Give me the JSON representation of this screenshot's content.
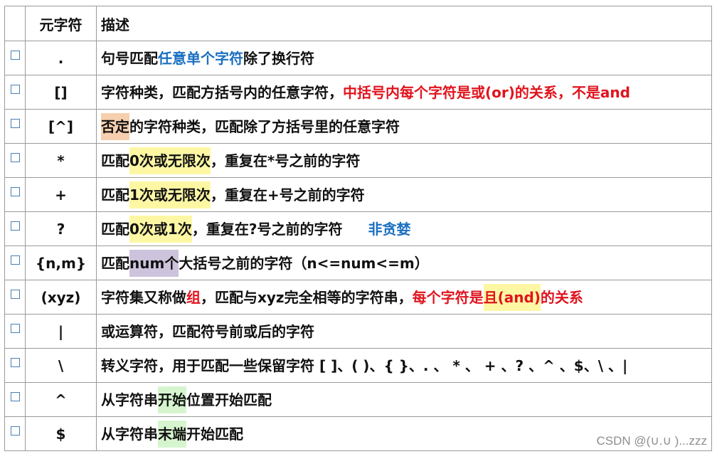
{
  "table": {
    "headers": {
      "symbol": "元字符",
      "description": "描述"
    },
    "rows": [
      {
        "symbol": ".",
        "segments": [
          {
            "text": "句号匹配"
          },
          {
            "text": "任意单个字符",
            "style": "blue"
          },
          {
            "text": "除了换行符"
          }
        ]
      },
      {
        "symbol": "[]",
        "segments": [
          {
            "text": "字符种类，匹配方括号内的任意字符，"
          },
          {
            "text": "中括号内每个字符是或(or)的关系，不是and",
            "style": "red"
          }
        ]
      },
      {
        "symbol": "[^]",
        "segments": [
          {
            "text": "否定",
            "style": "hl-orange"
          },
          {
            "text": "的字符种类，匹配除了方括号里的任意字符"
          }
        ]
      },
      {
        "symbol": "*",
        "segments": [
          {
            "text": "匹配"
          },
          {
            "text": "0次或无限次",
            "style": "hl-yellow"
          },
          {
            "text": "，重复在*号之前的字符"
          }
        ]
      },
      {
        "symbol": "+",
        "segments": [
          {
            "text": "匹配"
          },
          {
            "text": "1次或无限次",
            "style": "hl-yellow"
          },
          {
            "text": "，重复在+号之前的字符"
          }
        ]
      },
      {
        "symbol": "?",
        "segments": [
          {
            "text": "匹配"
          },
          {
            "text": "0次或1次",
            "style": "hl-yellow"
          },
          {
            "text": "，重复在?号之前的字符"
          },
          {
            "text": "非贪婪",
            "style": "blue",
            "gap": true
          }
        ]
      },
      {
        "symbol": "{n,m}",
        "segments": [
          {
            "text": "匹配"
          },
          {
            "text": "num个",
            "style": "hl-purple"
          },
          {
            "text": "大括号之前的字符（n<=num<=m）"
          }
        ]
      },
      {
        "symbol": "(xyz)",
        "segments": [
          {
            "text": "字符集又称做"
          },
          {
            "text": "组",
            "style": "red"
          },
          {
            "text": "，匹配与xyz完全相等的字符串，"
          },
          {
            "text": "每个字符是",
            "style": "red"
          },
          {
            "text": "且(and)",
            "style": "red hl-yellow"
          },
          {
            "text": "的关系",
            "style": "red"
          }
        ]
      },
      {
        "symbol": "|",
        "segments": [
          {
            "text": "或运算符，匹配符号前或后的字符"
          }
        ]
      },
      {
        "symbol": "\\",
        "segments": [
          {
            "text": "转义字符，用于匹配一些保留字符 [ ]、( )、{ }、. 、 * 、 + 、? 、^ 、$、\\ 、|"
          }
        ]
      },
      {
        "symbol": "^",
        "segments": [
          {
            "text": "从字符串"
          },
          {
            "text": "开始",
            "style": "hl-green"
          },
          {
            "text": "位置开始匹配"
          }
        ]
      },
      {
        "symbol": "$",
        "segments": [
          {
            "text": "从字符串"
          },
          {
            "text": "末端",
            "style": "hl-green"
          },
          {
            "text": "开始匹配"
          }
        ]
      }
    ]
  },
  "watermark": "CSDN @(∪.∪ )...zzz",
  "colors": {
    "blue": "#1a6fc0",
    "red": "#e0141e",
    "highlight_yellow": "#fdf7a4",
    "highlight_orange": "#f7cfae",
    "highlight_purple": "#cec3dc",
    "highlight_green": "#d6f5cf"
  }
}
